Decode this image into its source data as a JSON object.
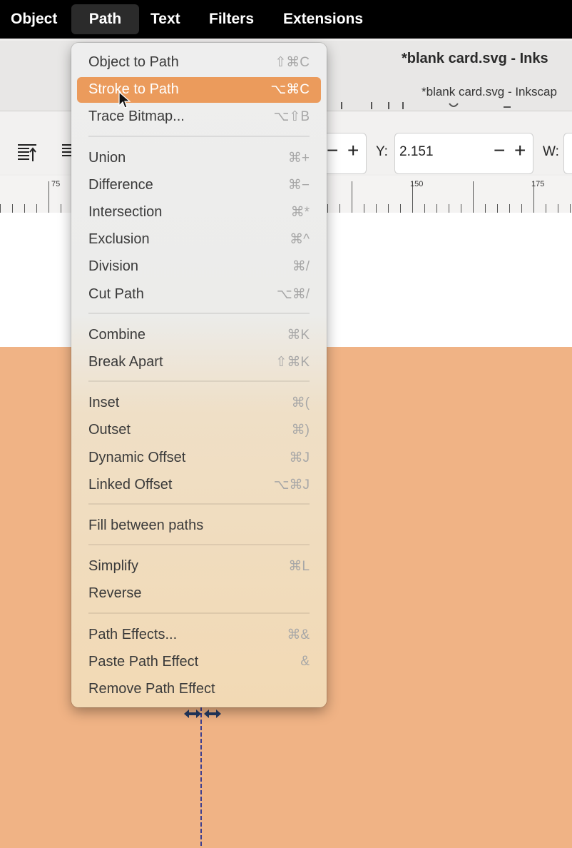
{
  "menubar": {
    "items": [
      "Object",
      "Path",
      "Text",
      "Filters",
      "Extensions"
    ],
    "active": "Path"
  },
  "window": {
    "title": "*blank card.svg - Inks",
    "tab": "*blank card.svg - Inkscap"
  },
  "toolbar": {
    "y_label": "Y:",
    "y_value": "2.151",
    "w_label": "W:",
    "minus": "−",
    "plus": "+"
  },
  "ruler": {
    "labels": [
      "75",
      "150",
      "175"
    ]
  },
  "path_menu": {
    "highlighted": "Stroke to Path",
    "groups": [
      [
        {
          "label": "Object to Path",
          "shortcut": "⇧⌘C"
        },
        {
          "label": "Stroke to Path",
          "shortcut": "⌥⌘C"
        },
        {
          "label": "Trace Bitmap...",
          "shortcut": "⌥⇧B"
        }
      ],
      [
        {
          "label": "Union",
          "shortcut": "⌘+"
        },
        {
          "label": "Difference",
          "shortcut": "⌘−"
        },
        {
          "label": "Intersection",
          "shortcut": "⌘*"
        },
        {
          "label": "Exclusion",
          "shortcut": "⌘^"
        },
        {
          "label": "Division",
          "shortcut": "⌘/"
        },
        {
          "label": "Cut Path",
          "shortcut": "⌥⌘/"
        }
      ],
      [
        {
          "label": "Combine",
          "shortcut": "⌘K"
        },
        {
          "label": "Break Apart",
          "shortcut": "⇧⌘K"
        }
      ],
      [
        {
          "label": "Inset",
          "shortcut": "⌘("
        },
        {
          "label": "Outset",
          "shortcut": "⌘)"
        },
        {
          "label": "Dynamic Offset",
          "shortcut": "⌘J"
        },
        {
          "label": "Linked Offset",
          "shortcut": "⌥⌘J"
        }
      ],
      [
        {
          "label": "Fill between paths",
          "shortcut": ""
        }
      ],
      [
        {
          "label": "Simplify",
          "shortcut": "⌘L"
        },
        {
          "label": "Reverse",
          "shortcut": ""
        }
      ],
      [
        {
          "label": "Path Effects...",
          "shortcut": "⌘&"
        },
        {
          "label": "Paste Path Effect",
          "shortcut": "&"
        },
        {
          "label": "Remove Path Effect",
          "shortcut": ""
        }
      ]
    ]
  },
  "colors": {
    "menu_highlight": "#eb9b5c",
    "card_fill": "#f0b385",
    "menubar_bg": "#000000"
  }
}
